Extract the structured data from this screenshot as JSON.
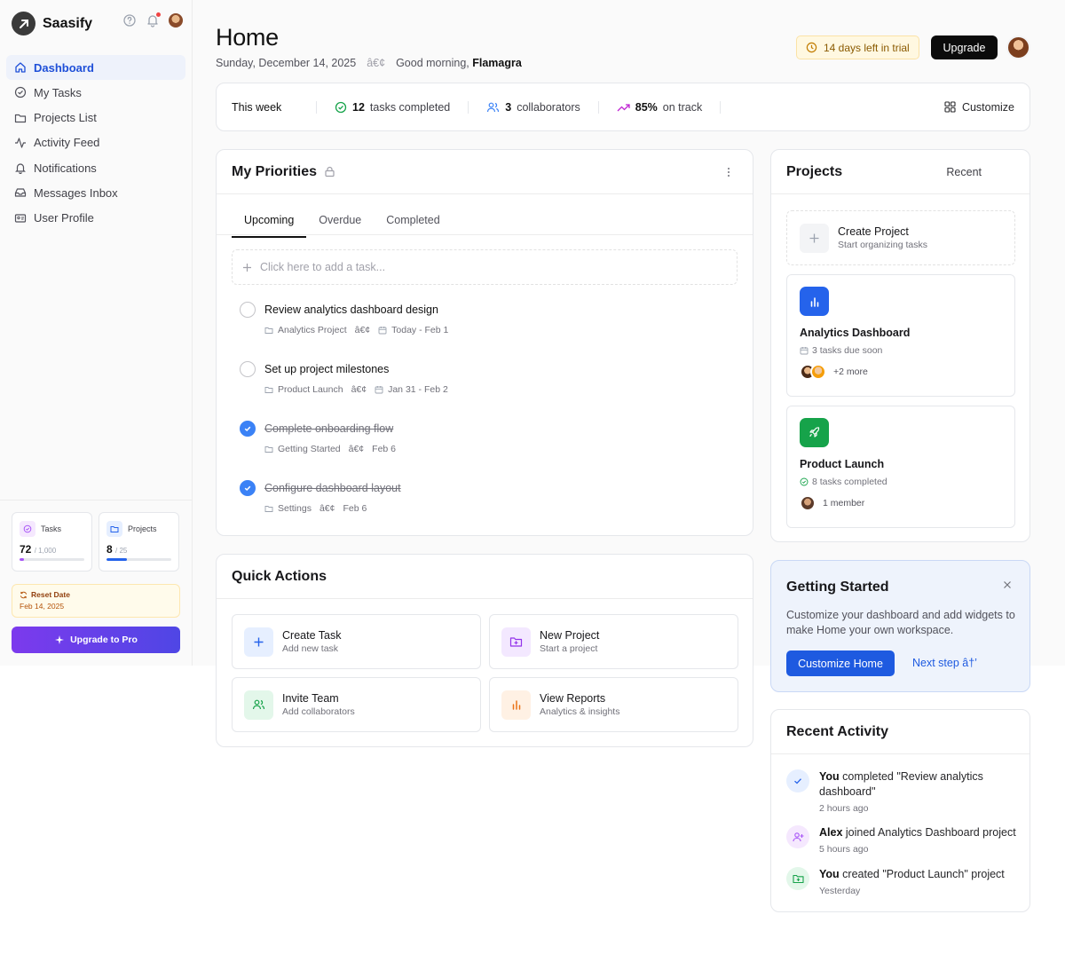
{
  "colors": {
    "accent": "#1e5ae0",
    "active_nav": "#eef2fb",
    "success": "#16a34a",
    "trial_bg": "#fff8e1",
    "upgrade_gradient": [
      "#7c3aed",
      "#4f46e5"
    ]
  },
  "sidebar": {
    "brand": "Saasify",
    "nav": [
      {
        "label": "Dashboard",
        "icon": "home-icon",
        "active": true
      },
      {
        "label": "My Tasks",
        "icon": "check-circle-icon"
      },
      {
        "label": "Projects List",
        "icon": "folder-icon"
      },
      {
        "label": "Activity Feed",
        "icon": "activity-icon"
      },
      {
        "label": "Notifications",
        "icon": "bell-icon"
      },
      {
        "label": "Messages Inbox",
        "icon": "inbox-icon"
      },
      {
        "label": "User Profile",
        "icon": "id-card-icon"
      }
    ],
    "stats": {
      "tasks": {
        "label": "Tasks",
        "value": "72",
        "total": "/ 1,000",
        "progress": 0.072
      },
      "projects": {
        "label": "Projects",
        "value": "8",
        "total": "/ 25",
        "progress": 0.32
      }
    },
    "reset": {
      "label": "Reset Date",
      "date": "Feb 14, 2025"
    },
    "upgrade_pro": "Upgrade to Pro"
  },
  "header": {
    "title": "Home",
    "date": "Sunday, December 14, 2025",
    "separator": "â€¢",
    "greeting": "Good morning,",
    "user": "Flamagra",
    "trial": "14 days left in trial",
    "upgrade": "Upgrade"
  },
  "week": {
    "label": "This week",
    "tasks_num": "12",
    "tasks_text": "tasks completed",
    "collab_num": "3",
    "collab_text": "collaborators",
    "track_num": "85%",
    "track_text": "on track",
    "customize": "Customize"
  },
  "priorities": {
    "title": "My Priorities",
    "tabs": [
      "Upcoming",
      "Overdue",
      "Completed"
    ],
    "add_placeholder": "Click here to add a task...",
    "tasks": [
      {
        "title": "Review analytics dashboard design",
        "project": "Analytics Project",
        "sep": "â€¢",
        "date": "Today - Feb 1",
        "done": false
      },
      {
        "title": "Set up project milestones",
        "project": "Product Launch",
        "sep": "â€¢",
        "date": "Jan 31 - Feb 2",
        "done": false
      },
      {
        "title": "Complete onboarding flow",
        "project": "Getting Started",
        "sep": "â€¢",
        "date": "Feb 6",
        "done": true
      },
      {
        "title": "Configure dashboard layout",
        "project": "Settings",
        "sep": "â€¢",
        "date": "Feb 6",
        "done": true
      }
    ]
  },
  "projects": {
    "title": "Projects",
    "recent": "Recent",
    "create": {
      "title": "Create Project",
      "sub": "Start organizing tasks"
    },
    "items": [
      {
        "name": "Analytics Dashboard",
        "meta": "3 tasks due soon",
        "people": "+2 more",
        "color": "#2563eb"
      },
      {
        "name": "Product Launch",
        "meta": "8 tasks completed",
        "people": "1 member",
        "color": "#16a34a"
      }
    ]
  },
  "quick": {
    "title": "Quick Actions",
    "actions": [
      {
        "title": "Create Task",
        "sub": "Add new task"
      },
      {
        "title": "New Project",
        "sub": "Start a project"
      },
      {
        "title": "Invite Team",
        "sub": "Add collaborators"
      },
      {
        "title": "View Reports",
        "sub": "Analytics & insights"
      }
    ]
  },
  "getting_started": {
    "title": "Getting Started",
    "text": "Customize your dashboard and add widgets to make Home your own workspace.",
    "button": "Customize Home",
    "link": "Next step â†’"
  },
  "activity": {
    "title": "Recent Activity",
    "items": [
      {
        "actor": "You",
        "text": "completed \"Review analytics dashboard\"",
        "time": "2 hours ago"
      },
      {
        "actor": "Alex",
        "text": "joined Analytics Dashboard project",
        "time": "5 hours ago"
      },
      {
        "actor": "You",
        "text": "created \"Product Launch\" project",
        "time": "Yesterday"
      }
    ]
  }
}
